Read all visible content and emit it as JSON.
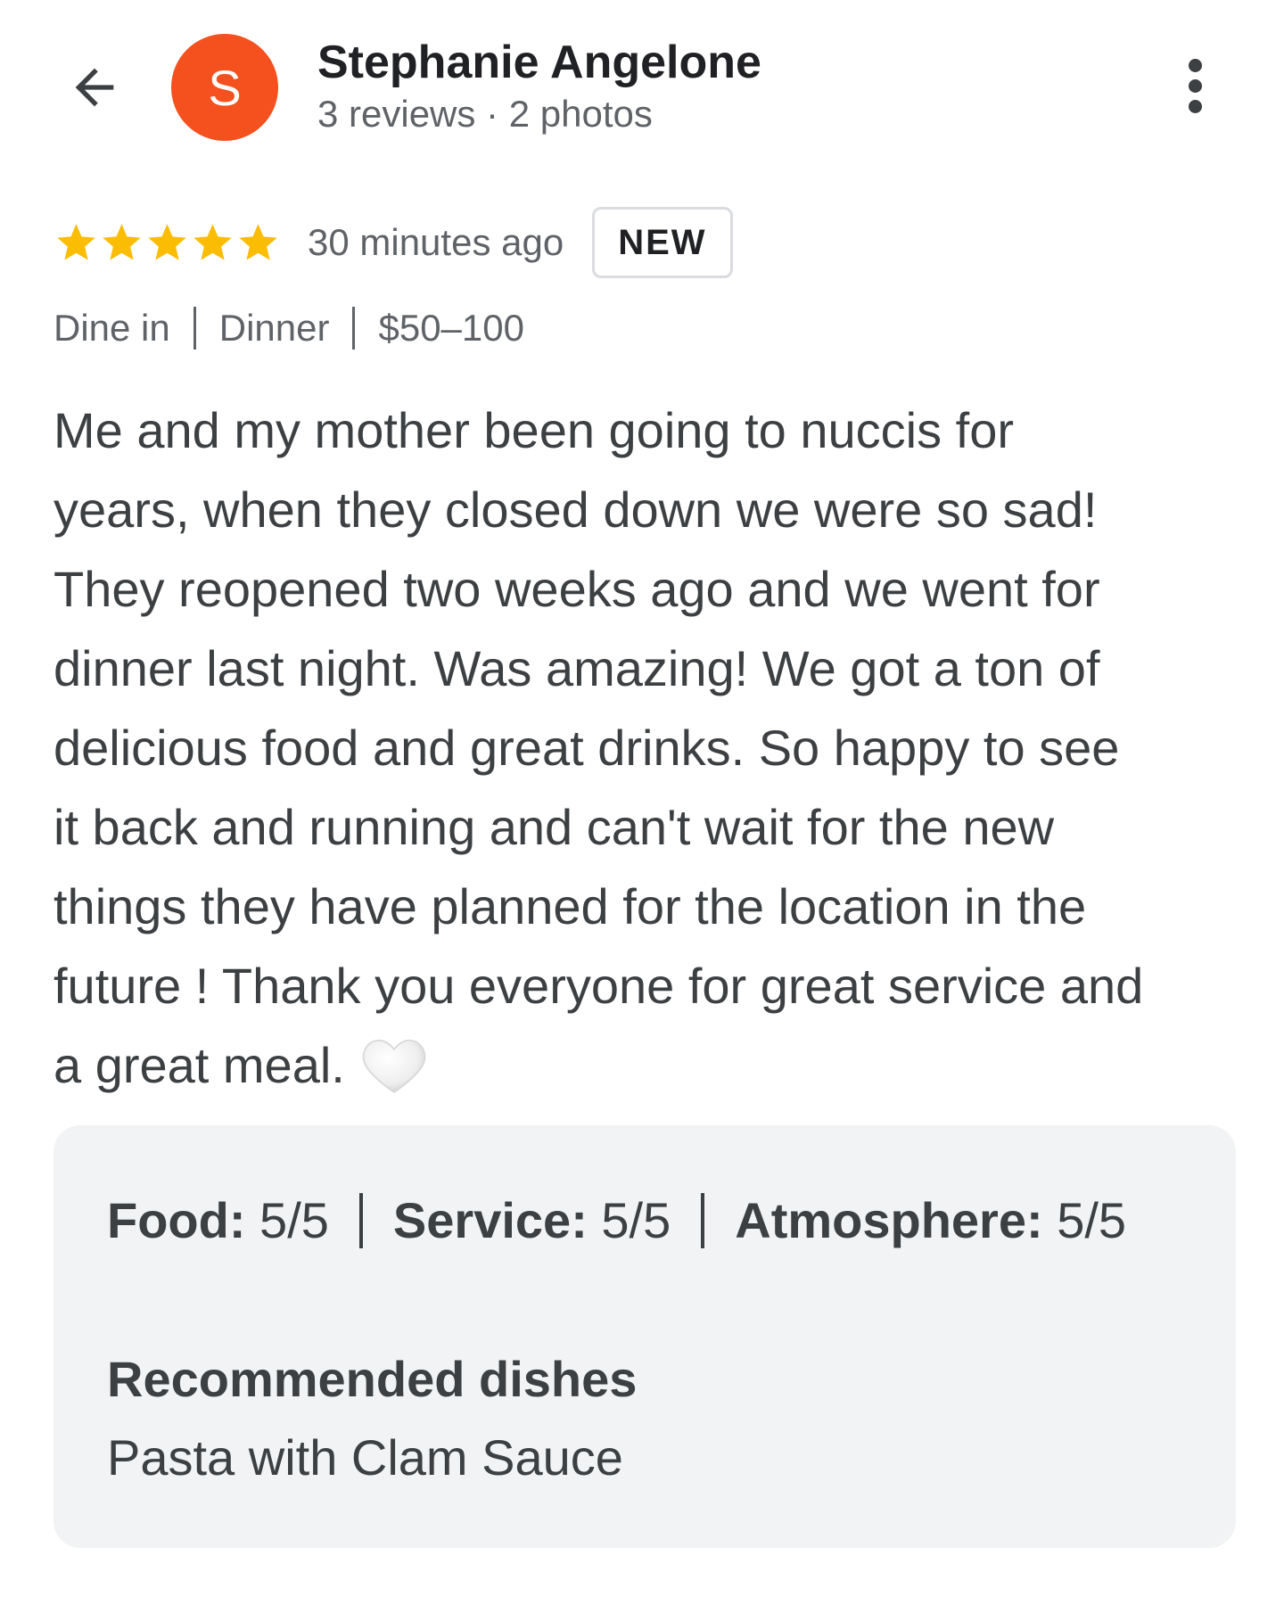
{
  "reviewer": {
    "initial": "S",
    "name": "Stephanie Angelone",
    "stats": "3 reviews · 2 photos",
    "avatar_color": "#f4511e"
  },
  "review": {
    "rating": 5,
    "rating_max": 5,
    "star_color": "#fbbc04",
    "time": "30 minutes ago",
    "badge": "NEW",
    "tags": [
      "Dine in",
      "Dinner",
      "$50–100"
    ],
    "text_lines": [
      "Me and my mother been going to nuccis for",
      "years, when they closed down we were so sad!",
      "They reopened two weeks ago and we went for",
      "dinner last night. Was amazing! We got a ton of",
      "delicious food and great drinks. So happy to see",
      "it back and running and can't wait for the new",
      "things they have planned for the location in the",
      "future ! Thank you everyone for great service and",
      "a great meal."
    ],
    "emoji": "white-heart"
  },
  "details": {
    "scores": [
      {
        "label": "Food:",
        "value": "5/5"
      },
      {
        "label": "Service:",
        "value": "5/5"
      },
      {
        "label": "Atmosphere:",
        "value": "5/5"
      }
    ],
    "recommended_title": "Recommended dishes",
    "recommended_value": "Pasta with Clam Sauce"
  },
  "icons": {
    "back": "arrow-back-icon",
    "more": "more-vert-icon",
    "star": "star-icon",
    "heart": "white-heart-icon"
  }
}
